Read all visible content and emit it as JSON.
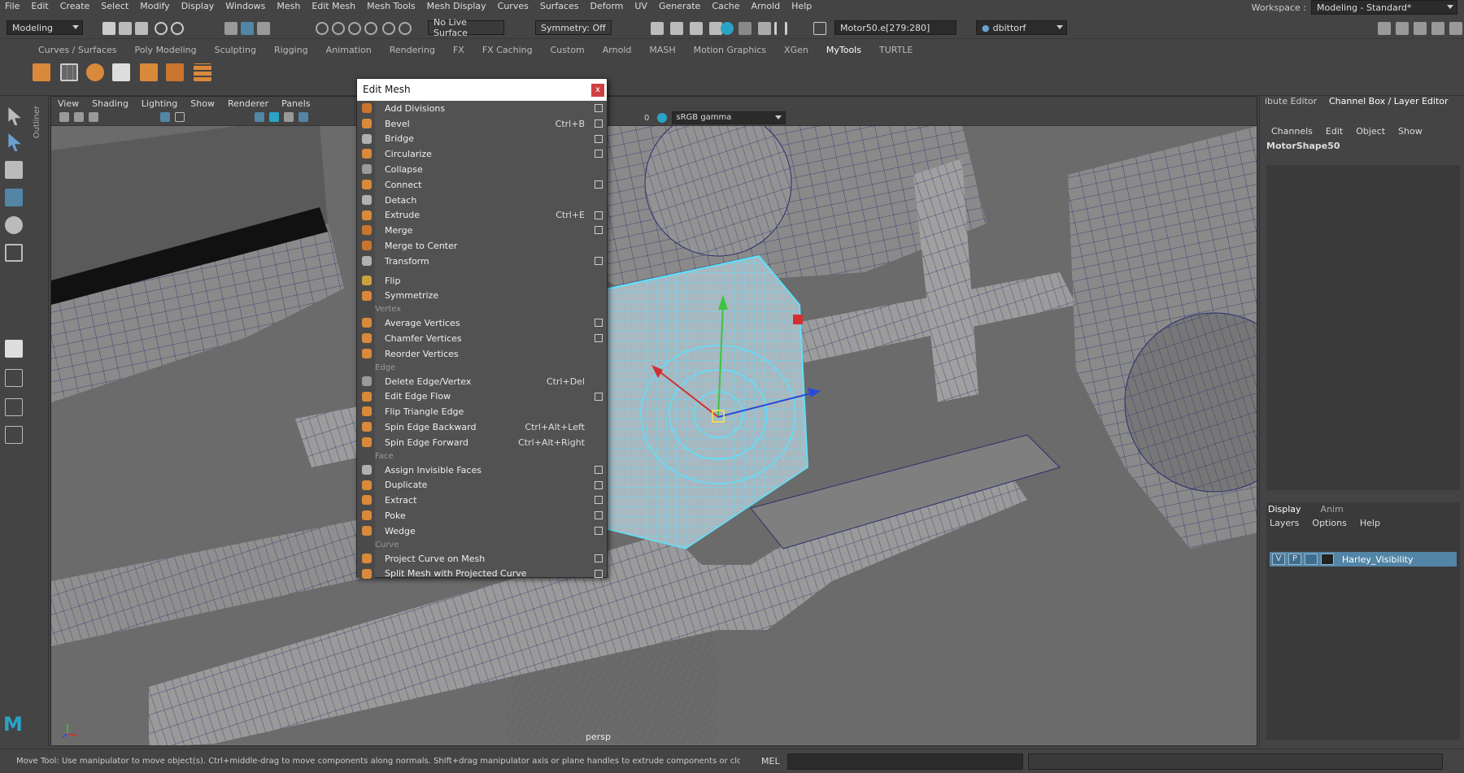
{
  "menubar": {
    "items": [
      "File",
      "Edit",
      "Create",
      "Select",
      "Modify",
      "Display",
      "Windows",
      "Mesh",
      "Edit Mesh",
      "Mesh Tools",
      "Mesh Display",
      "Curves",
      "Surfaces",
      "Deform",
      "UV",
      "Generate",
      "Cache",
      "Arnold",
      "Help"
    ],
    "workspace_label": "Workspace :",
    "workspace_value": "Modeling - Standard*"
  },
  "statusline": {
    "menuset": "Modeling",
    "live_surface": "No Live Surface",
    "symmetry": "Symmetry: Off",
    "selection_field": "Motor50.e[279:280]",
    "user": "dbittorf"
  },
  "shelf": {
    "tabs": [
      "Curves / Surfaces",
      "Poly Modeling",
      "Sculpting",
      "Rigging",
      "Animation",
      "Rendering",
      "FX",
      "FX Caching",
      "Custom",
      "Arnold",
      "MASH",
      "Motion Graphics",
      "XGen",
      "MyTools",
      "TURTLE"
    ],
    "active_tab": "MyTools"
  },
  "outliner_label": "Outliner",
  "viewport": {
    "menus": [
      "View",
      "Shading",
      "Lighting",
      "Show",
      "Renderer",
      "Panels"
    ],
    "exposure_value": "0",
    "color_space": "sRGB gamma",
    "camera_label": "persp"
  },
  "edit_mesh_menu": {
    "title": "Edit Mesh",
    "close_label": "x",
    "groups": [
      {
        "section": "",
        "items": [
          {
            "label": "Add Divisions",
            "shortcut": "",
            "option": true,
            "color": "#c9752e"
          },
          {
            "label": "Bevel",
            "shortcut": "Ctrl+B",
            "option": true,
            "color": "#d9893a"
          },
          {
            "label": "Bridge",
            "shortcut": "",
            "option": true,
            "color": "#b0b0b0"
          },
          {
            "label": "Circularize",
            "shortcut": "",
            "option": true,
            "color": "#d9893a"
          },
          {
            "label": "Collapse",
            "shortcut": "",
            "option": false,
            "color": "#9a9a9a"
          },
          {
            "label": "Connect",
            "shortcut": "",
            "option": true,
            "color": "#d9893a"
          },
          {
            "label": "Detach",
            "shortcut": "",
            "option": false,
            "color": "#b0b0b0"
          },
          {
            "label": "Extrude",
            "shortcut": "Ctrl+E",
            "option": true,
            "color": "#d9893a"
          },
          {
            "label": "Merge",
            "shortcut": "",
            "option": true,
            "color": "#c9752e"
          },
          {
            "label": "Merge to Center",
            "shortcut": "",
            "option": false,
            "color": "#c9752e"
          },
          {
            "label": "Transform",
            "shortcut": "",
            "option": true,
            "color": "#b0b0b0"
          }
        ]
      },
      {
        "section": "",
        "items": [
          {
            "label": "Flip",
            "shortcut": "",
            "option": false,
            "color": "#c9a23e"
          },
          {
            "label": "Symmetrize",
            "shortcut": "",
            "option": false,
            "color": "#d9893a"
          }
        ]
      },
      {
        "section": "Vertex",
        "items": [
          {
            "label": "Average Vertices",
            "shortcut": "",
            "option": true,
            "color": "#d9893a"
          },
          {
            "label": "Chamfer Vertices",
            "shortcut": "",
            "option": true,
            "color": "#d9893a"
          },
          {
            "label": "Reorder Vertices",
            "shortcut": "",
            "option": false,
            "color": "#d9893a"
          }
        ]
      },
      {
        "section": "Edge",
        "items": [
          {
            "label": "Delete Edge/Vertex",
            "shortcut": "Ctrl+Del",
            "option": false,
            "color": "#9a9a9a"
          },
          {
            "label": "Edit Edge Flow",
            "shortcut": "",
            "option": true,
            "color": "#d9893a"
          },
          {
            "label": "Flip Triangle Edge",
            "shortcut": "",
            "option": false,
            "color": "#d9893a"
          },
          {
            "label": "Spin Edge Backward",
            "shortcut": "Ctrl+Alt+Left",
            "option": false,
            "color": "#d9893a"
          },
          {
            "label": "Spin Edge Forward",
            "shortcut": "Ctrl+Alt+Right",
            "option": false,
            "color": "#d9893a"
          }
        ]
      },
      {
        "section": "Face",
        "items": [
          {
            "label": "Assign Invisible Faces",
            "shortcut": "",
            "option": true,
            "color": "#b0b0b0"
          },
          {
            "label": "Duplicate",
            "shortcut": "",
            "option": true,
            "color": "#d9893a"
          },
          {
            "label": "Extract",
            "shortcut": "",
            "option": true,
            "color": "#d9893a"
          },
          {
            "label": "Poke",
            "shortcut": "",
            "option": true,
            "color": "#d9893a"
          },
          {
            "label": "Wedge",
            "shortcut": "",
            "option": true,
            "color": "#d9893a"
          }
        ]
      },
      {
        "section": "Curve",
        "items": [
          {
            "label": "Project Curve on Mesh",
            "shortcut": "",
            "option": true,
            "color": "#d9893a"
          },
          {
            "label": "Split Mesh with Projected Curve",
            "shortcut": "",
            "option": true,
            "color": "#d9893a"
          }
        ]
      }
    ]
  },
  "right_panel": {
    "tab_attr": "ibute Editor",
    "tab_channel": "Channel Box / Layer Editor",
    "channel_menu": [
      "Channels",
      "Edit",
      "Object",
      "Show"
    ],
    "shape_name": "MotorShape50",
    "display_tabs": [
      "Display",
      "Anim"
    ],
    "layer_menu": [
      "Layers",
      "Options",
      "Help"
    ],
    "layer": {
      "v": "V",
      "p": "P",
      "name": "Harley_Visibility"
    }
  },
  "helpline": {
    "text": "Move Tool: Use manipulator to move object(s). Ctrl+middle-drag to move components along normals. Shift+drag manipulator axis or plane handles to extrude components or clone objects. Ctrl+Shift+drag to constra",
    "mel_label": "MEL"
  },
  "colors": {
    "accent_select": "#5285a6",
    "selection_wire": "#5ce1ff",
    "menu_bg": "#525252"
  }
}
